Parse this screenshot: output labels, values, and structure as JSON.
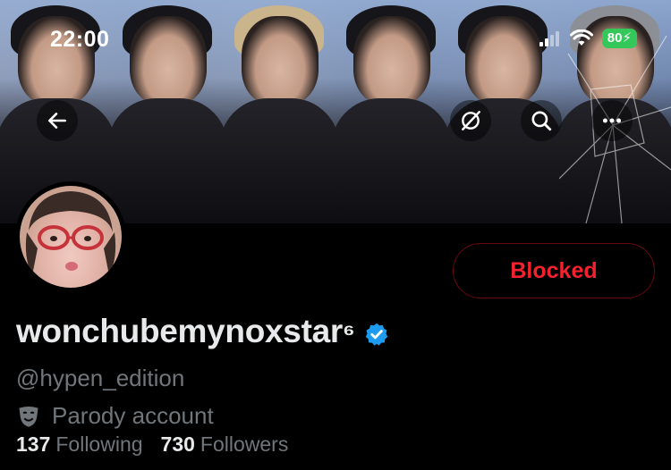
{
  "status_bar": {
    "time": "22:00",
    "battery": "80",
    "icons": [
      "signal-icon",
      "wifi-icon",
      "battery-charging-icon"
    ]
  },
  "header_actions": {
    "back_icon": "back-arrow-icon",
    "grok_icon": "grok-icon",
    "search_icon": "search-icon",
    "more_icon": "more-icon"
  },
  "profile": {
    "display_name": "wonchubemynoxstar",
    "display_name_suffix": "⁶",
    "handle": "@hypen_edition",
    "label": "Parody account",
    "label_icon": "theater-masks-icon",
    "following_count": "137",
    "following_label": "Following",
    "followers_count": "730",
    "followers_label": "Followers"
  },
  "actions": {
    "blocked_label": "Blocked"
  },
  "colors": {
    "accent_blue": "#1d9bf0",
    "blocked_red": "#f4212e",
    "muted_text": "#71767b",
    "battery_green": "#34c759"
  }
}
